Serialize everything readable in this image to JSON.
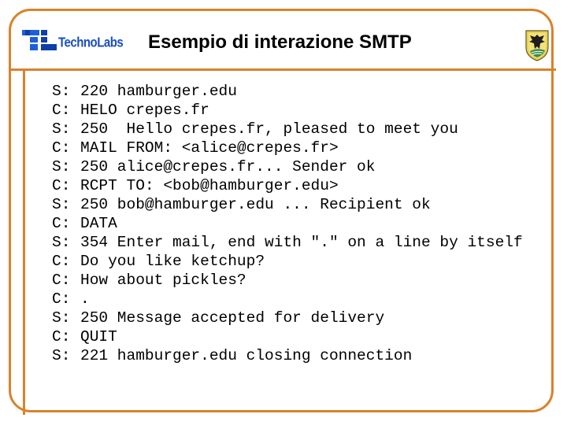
{
  "slide": {
    "title": "Esempio di interazione SMTP",
    "logo_text": "TechnoLabs",
    "frame_color": "#D9822B",
    "logo_color": "#1E5FD9"
  },
  "dialogue": [
    {
      "speaker": "S:",
      "text": "220 hamburger.edu"
    },
    {
      "speaker": "C:",
      "text": "HELO crepes.fr"
    },
    {
      "speaker": "S:",
      "text": "250  Hello crepes.fr, pleased to meet you"
    },
    {
      "speaker": "C:",
      "text": "MAIL FROM: <alice@crepes.fr>"
    },
    {
      "speaker": "S:",
      "text": "250 alice@crepes.fr... Sender ok"
    },
    {
      "speaker": "C:",
      "text": "RCPT TO: <bob@hamburger.edu>"
    },
    {
      "speaker": "S:",
      "text": "250 bob@hamburger.edu ... Recipient ok"
    },
    {
      "speaker": "C:",
      "text": "DATA"
    },
    {
      "speaker": "S:",
      "text": "354 Enter mail, end with \".\" on a line by itself"
    },
    {
      "speaker": "C:",
      "text": "Do you like ketchup?"
    },
    {
      "speaker": "C:",
      "text": "How about pickles?"
    },
    {
      "speaker": "C:",
      "text": "."
    },
    {
      "speaker": "S:",
      "text": "250 Message accepted for delivery"
    },
    {
      "speaker": "C:",
      "text": "QUIT"
    },
    {
      "speaker": "S:",
      "text": "221 hamburger.edu closing connection"
    }
  ]
}
